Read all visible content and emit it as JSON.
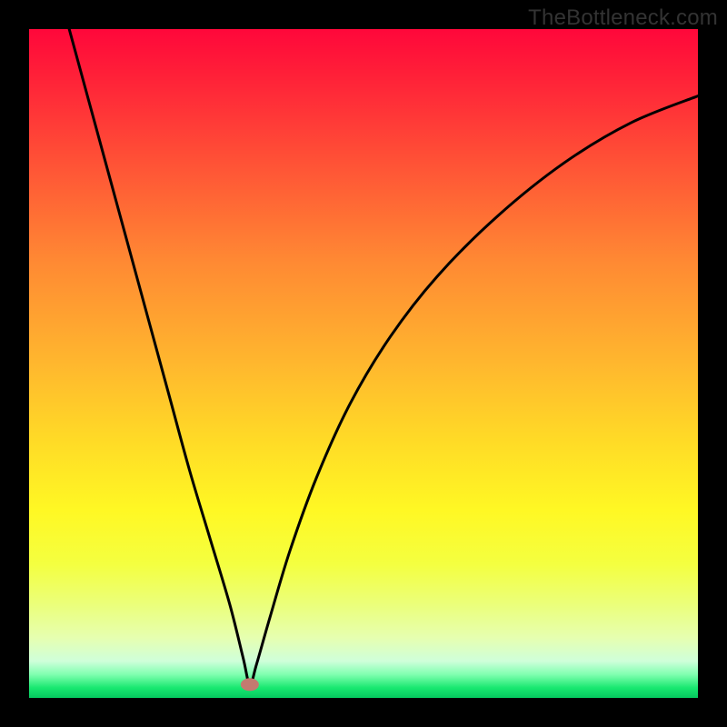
{
  "watermark": "TheBottleneck.com",
  "colors": {
    "frame": "#000000",
    "curve": "#000000",
    "marker": "#c47a70",
    "gradient_stops": [
      {
        "offset": 0.0,
        "color": "#ff073a"
      },
      {
        "offset": 0.08,
        "color": "#ff2438"
      },
      {
        "offset": 0.2,
        "color": "#ff5236"
      },
      {
        "offset": 0.35,
        "color": "#ff8a33"
      },
      {
        "offset": 0.5,
        "color": "#ffb72e"
      },
      {
        "offset": 0.62,
        "color": "#ffdc26"
      },
      {
        "offset": 0.72,
        "color": "#fff824"
      },
      {
        "offset": 0.8,
        "color": "#f4ff40"
      },
      {
        "offset": 0.86,
        "color": "#ebff7a"
      },
      {
        "offset": 0.91,
        "color": "#e6ffb0"
      },
      {
        "offset": 0.945,
        "color": "#cfffda"
      },
      {
        "offset": 0.965,
        "color": "#80ffb0"
      },
      {
        "offset": 0.985,
        "color": "#18e870"
      },
      {
        "offset": 1.0,
        "color": "#05c95f"
      }
    ]
  },
  "chart_data": {
    "type": "line",
    "title": "",
    "xlabel": "",
    "ylabel": "",
    "xlim": [
      0,
      100
    ],
    "ylim": [
      0,
      100
    ],
    "marker": {
      "x": 33,
      "y": 2
    },
    "series": [
      {
        "name": "bottleneck-curve",
        "x": [
          6,
          9,
          12,
          15,
          18,
          21,
          24,
          27,
          30,
          32,
          33,
          34,
          36,
          39,
          43,
          48,
          54,
          61,
          70,
          80,
          90,
          100
        ],
        "values": [
          100,
          89,
          78,
          67,
          56,
          45,
          34,
          24,
          14,
          6,
          2,
          5,
          12,
          22,
          33,
          44,
          54,
          63,
          72,
          80,
          86,
          90
        ]
      }
    ]
  }
}
